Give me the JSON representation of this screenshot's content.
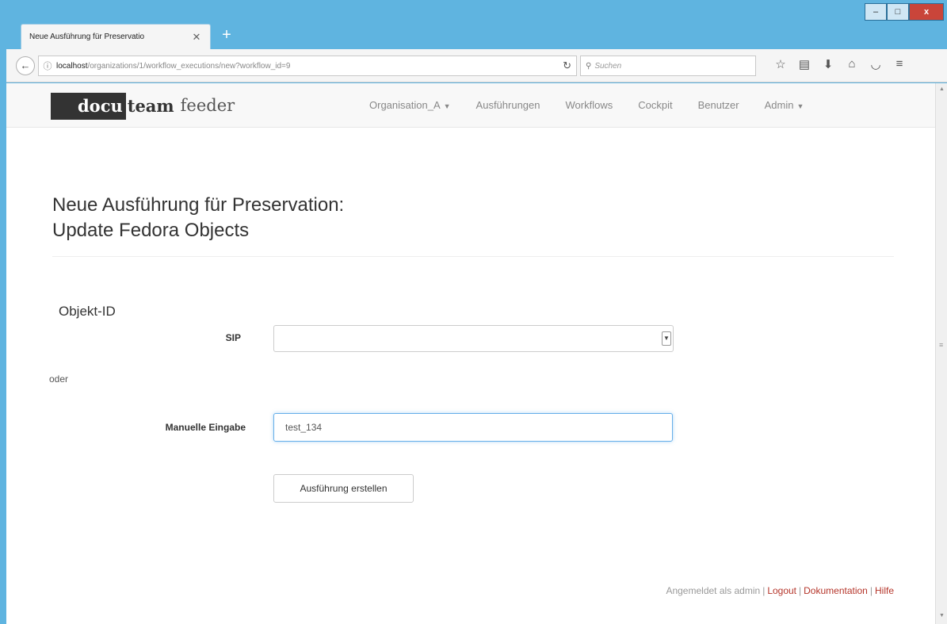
{
  "browser": {
    "tab_title": "Neue Ausführung für Preservatio",
    "tab_close": "✕",
    "new_tab": "+",
    "url_host": "localhost",
    "url_path": "/organizations/1/workflow_executions/new?workflow_id=9",
    "search_placeholder": "Suchen",
    "win_minimize": "–",
    "win_maximize": "□",
    "win_close": "x"
  },
  "app": {
    "brand_docu": "docu",
    "brand_team": "team",
    "brand_feeder": "feeder",
    "nav": {
      "organisation": "Organisation_A",
      "executions": "Ausführungen",
      "workflows": "Workflows",
      "cockpit": "Cockpit",
      "users": "Benutzer",
      "admin": "Admin"
    }
  },
  "form": {
    "title_line1": "Neue Ausführung für Preservation:",
    "title_line2": "Update Fedora Objects",
    "section_label": "Objekt-ID",
    "sip_label": "SIP",
    "sip_value": "",
    "oder": "oder",
    "manual_label": "Manuelle Eingabe",
    "manual_value": "test_134",
    "submit_label": "Ausführung erstellen"
  },
  "footer": {
    "logged_in_as": "Angemeldet als admin",
    "logout": "Logout",
    "documentation": "Dokumentation",
    "help": "Hilfe"
  },
  "colors": {
    "link": "#b5352a",
    "window_frame": "#5fb4e0"
  }
}
